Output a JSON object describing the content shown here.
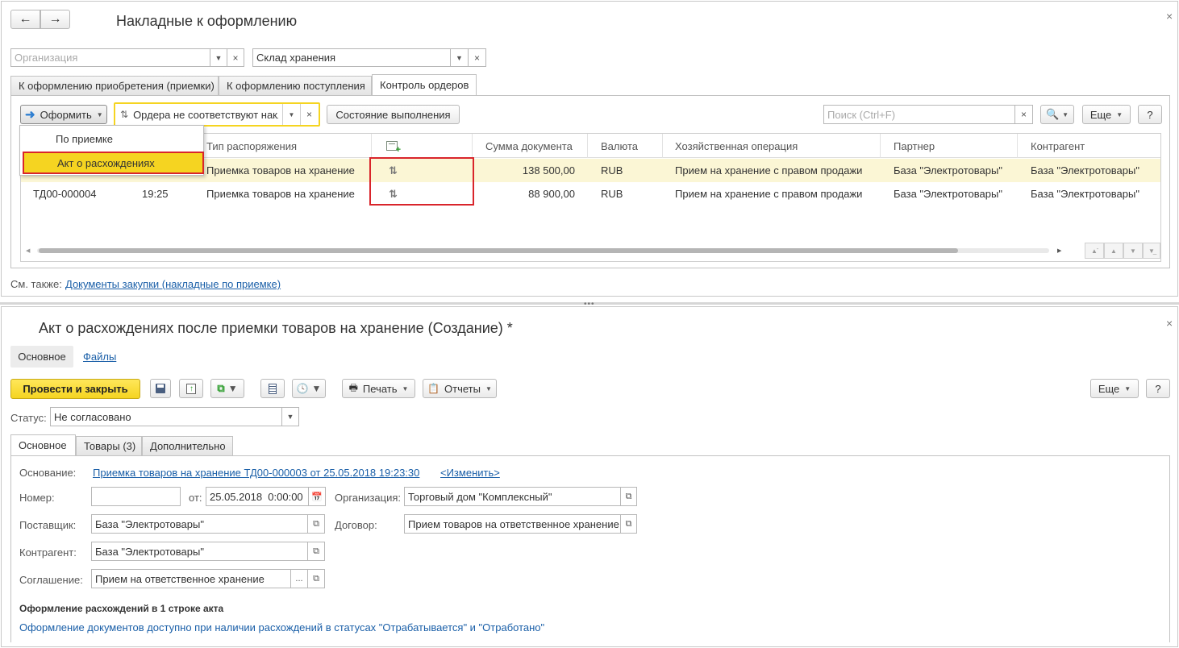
{
  "top": {
    "title": "Накладные к оформлению",
    "org_placeholder": "Организация",
    "warehouse_value": "Склад хранения",
    "tabs": [
      {
        "label": "К оформлению приобретения (приемки)"
      },
      {
        "label": "К оформлению поступления"
      },
      {
        "label": "Контроль ордеров"
      }
    ],
    "toolbar": {
      "oformit_label": "Оформить",
      "filter_value": "Ордера не соответствуют накл",
      "status_btn_label": "Состояние выполнения",
      "search_placeholder": "Поиск (Ctrl+F)",
      "more_label": "Еще",
      "help_label": "?"
    },
    "menu": {
      "items": [
        {
          "label": "По приемке"
        },
        {
          "label": "Акт о расхождениях"
        }
      ]
    },
    "table": {
      "headers": [
        "Тип распоряжения",
        "Сумма документа",
        "Валюта",
        "Хозяйственная операция",
        "Партнер",
        "Контрагент"
      ],
      "rows": [
        {
          "number": "",
          "time": "",
          "type": "Приемка товаров на хранение",
          "sum": "138 500,00",
          "currency": "RUB",
          "operation": "Прием на хранение с правом продажи",
          "partner": "База \"Электротовары\"",
          "counterparty": "База \"Электротовары\""
        },
        {
          "number": "ТД00-000004",
          "time": "19:25",
          "type": "Приемка товаров на хранение",
          "sum": "88 900,00",
          "currency": "RUB",
          "operation": "Прием на хранение с правом продажи",
          "partner": "База \"Электротовары\"",
          "counterparty": "База \"Электротовары\""
        }
      ]
    },
    "see_also_label": "См. также:",
    "see_also_link": "Документы закупки (накладные по приемке)"
  },
  "bottom": {
    "title": "Акт о расхождениях после приемки товаров на хранение (Создание) *",
    "nav": [
      {
        "label": "Основное"
      },
      {
        "label": "Файлы"
      }
    ],
    "toolbar": {
      "post_close_label": "Провести и закрыть",
      "print_label": "Печать",
      "reports_label": "Отчеты",
      "more_label": "Еще",
      "help_label": "?"
    },
    "status_label": "Статус:",
    "status_value": "Не согласовано",
    "tabs": [
      {
        "label": "Основное"
      },
      {
        "label": "Товары (3)"
      },
      {
        "label": "Дополнительно"
      }
    ],
    "form": {
      "basis_label": "Основание:",
      "basis_link": "Приемка товаров на хранение ТД00-000003 от 25.05.2018 19:23:30",
      "change_link": "<Изменить>",
      "number_label": "Номер:",
      "number_value": "",
      "from_label": "от:",
      "date_value": "25.05.2018  0:00:00",
      "org_label": "Организация:",
      "org_value": "Торговый дом \"Комплексный\"",
      "supplier_label": "Поставщик:",
      "supplier_value": "База \"Электротовары\"",
      "contract_label": "Договор:",
      "contract_value": "Прием товаров на ответственное хранение",
      "counterparty_label": "Контрагент:",
      "counterparty_value": "База \"Электротовары\"",
      "agreement_label": "Соглашение:",
      "agreement_value": "Прием на ответственное хранение",
      "agreement_btn": "...",
      "section_title": "Оформление расхождений в 1 строке акта",
      "section_note": "Оформление документов доступно при наличии расхождений в статусах \"Отрабатывается\" и \"Отработано\""
    }
  },
  "colors": {
    "highlight_row": "#fbf6d5",
    "accent_yellow": "#f5d421",
    "red_outline": "#d9252b",
    "link": "#1a5fa8"
  }
}
